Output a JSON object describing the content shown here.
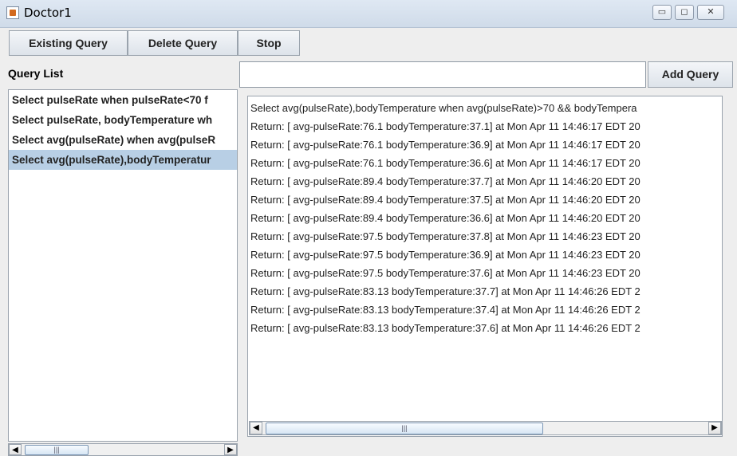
{
  "window": {
    "title": "Doctor1",
    "minimize": "▭",
    "maximize": "◻",
    "close": "✕"
  },
  "toolbar": {
    "existing_query": "Existing Query",
    "delete_query": "Delete Query",
    "stop": "Stop"
  },
  "query_list": {
    "label": "Query List",
    "items": [
      "Select pulseRate when pulseRate<70 f",
      "Select pulseRate, bodyTemperature wh",
      "Select avg(pulseRate) when avg(pulseR",
      "Select avg(pulseRate),bodyTemperatur"
    ],
    "selected_index": 3
  },
  "query_input": {
    "value": ""
  },
  "add_query": "Add Query",
  "results": [
    "Select avg(pulseRate),bodyTemperature when avg(pulseRate)>70 && bodyTempera",
    "Return: [ avg-pulseRate:76.1 bodyTemperature:37.1] at Mon Apr 11 14:46:17 EDT 20",
    "Return: [ avg-pulseRate:76.1 bodyTemperature:36.9] at Mon Apr 11 14:46:17 EDT 20",
    "Return: [ avg-pulseRate:76.1 bodyTemperature:36.6] at Mon Apr 11 14:46:17 EDT 20",
    "Return: [ avg-pulseRate:89.4 bodyTemperature:37.7] at Mon Apr 11 14:46:20 EDT 20",
    "Return: [ avg-pulseRate:89.4 bodyTemperature:37.5] at Mon Apr 11 14:46:20 EDT 20",
    "Return: [ avg-pulseRate:89.4 bodyTemperature:36.6] at Mon Apr 11 14:46:20 EDT 20",
    "Return: [ avg-pulseRate:97.5 bodyTemperature:37.8] at Mon Apr 11 14:46:23 EDT 20",
    "Return: [ avg-pulseRate:97.5 bodyTemperature:36.9] at Mon Apr 11 14:46:23 EDT 20",
    "Return: [ avg-pulseRate:97.5 bodyTemperature:37.6] at Mon Apr 11 14:46:23 EDT 20",
    "Return: [ avg-pulseRate:83.13 bodyTemperature:37.7] at Mon Apr 11 14:46:26 EDT 2",
    "Return: [ avg-pulseRate:83.13 bodyTemperature:37.4] at Mon Apr 11 14:46:26 EDT 2",
    "Return: [ avg-pulseRate:83.13 bodyTemperature:37.6] at Mon Apr 11 14:46:26 EDT 2"
  ],
  "scroll": {
    "left_arrow": "◀",
    "right_arrow": "▶",
    "thumb_grip": "|||"
  }
}
